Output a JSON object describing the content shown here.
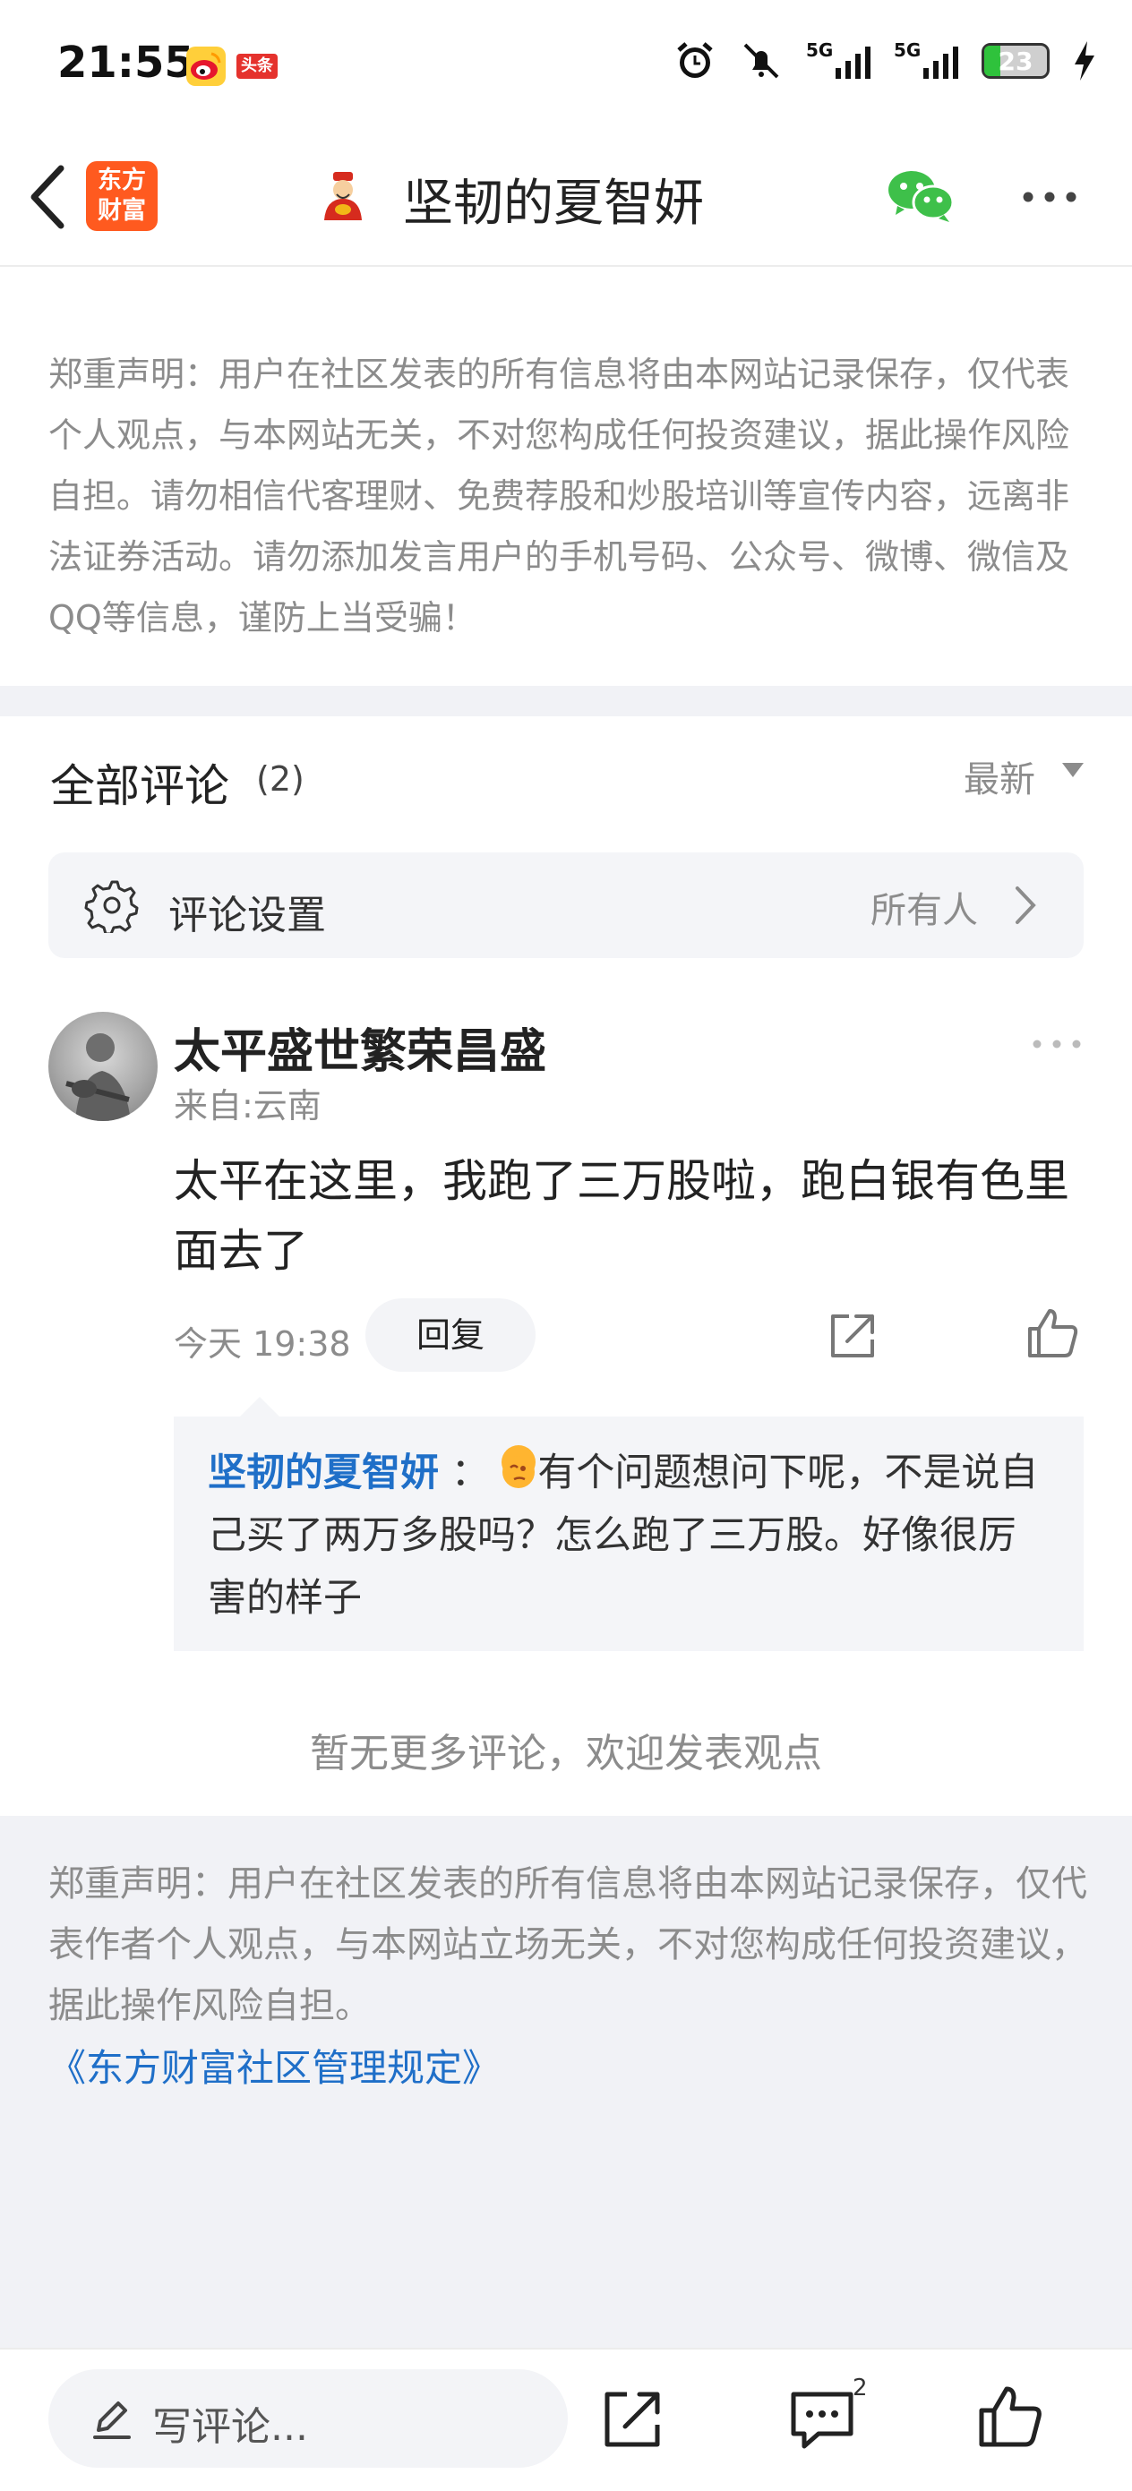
{
  "status_bar": {
    "time": "21:55",
    "toutiao_label": "头条",
    "network_1": "5G",
    "network_2": "5G",
    "battery": "23"
  },
  "nav": {
    "logo_text_1": "东方",
    "logo_text_2": "财富",
    "title": "坚韧的夏智妍"
  },
  "disclaimer_top": "郑重声明：用户在社区发表的所有信息将由本网站记录保存，仅代表个人观点，与本网站无关，不对您构成任何投资建议，据此操作风险自担。请勿相信代客理财、免费荐股和炒股培训等宣传内容，远离非法证券活动。请勿添加发言用户的手机号码、公众号、微博、微信及QQ等信息，谨防上当受骗！",
  "comments_header": {
    "label": "全部评论",
    "count": "(2)",
    "sort": "最新"
  },
  "settings": {
    "label": "评论设置",
    "value": "所有人"
  },
  "comment": {
    "user": "太平盛世繁荣昌盛",
    "location": "来自:云南",
    "text": "太平在这里，我跑了三万股啦，跑白银有色里面去了",
    "time": "今天 19:38",
    "reply_label": "回复",
    "quoted_user": "坚韧的夏智妍",
    "quoted_separator": "：",
    "quoted_text": "有个问题想问下呢，不是说自己买了两万多股吗？怎么跑了三万股。好像很厉害的样子"
  },
  "no_more": "暂无更多评论，欢迎发表观点",
  "disclaimer_bottom": "郑重声明：用户在社区发表的所有信息将由本网站记录保存，仅代表作者个人观点，与本网站立场无关，不对您构成任何投资建议，据此操作风险自担。",
  "rules_link": "《东方财富社区管理规定》",
  "bottom_bar": {
    "compose_placeholder": "写评论...",
    "comment_count": "2"
  },
  "colors": {
    "link_blue": "#1f6fc8",
    "logo_orange": "#ff5a1f",
    "wechat_green": "#3ec04a",
    "muted_gray": "#8c8c8c"
  }
}
